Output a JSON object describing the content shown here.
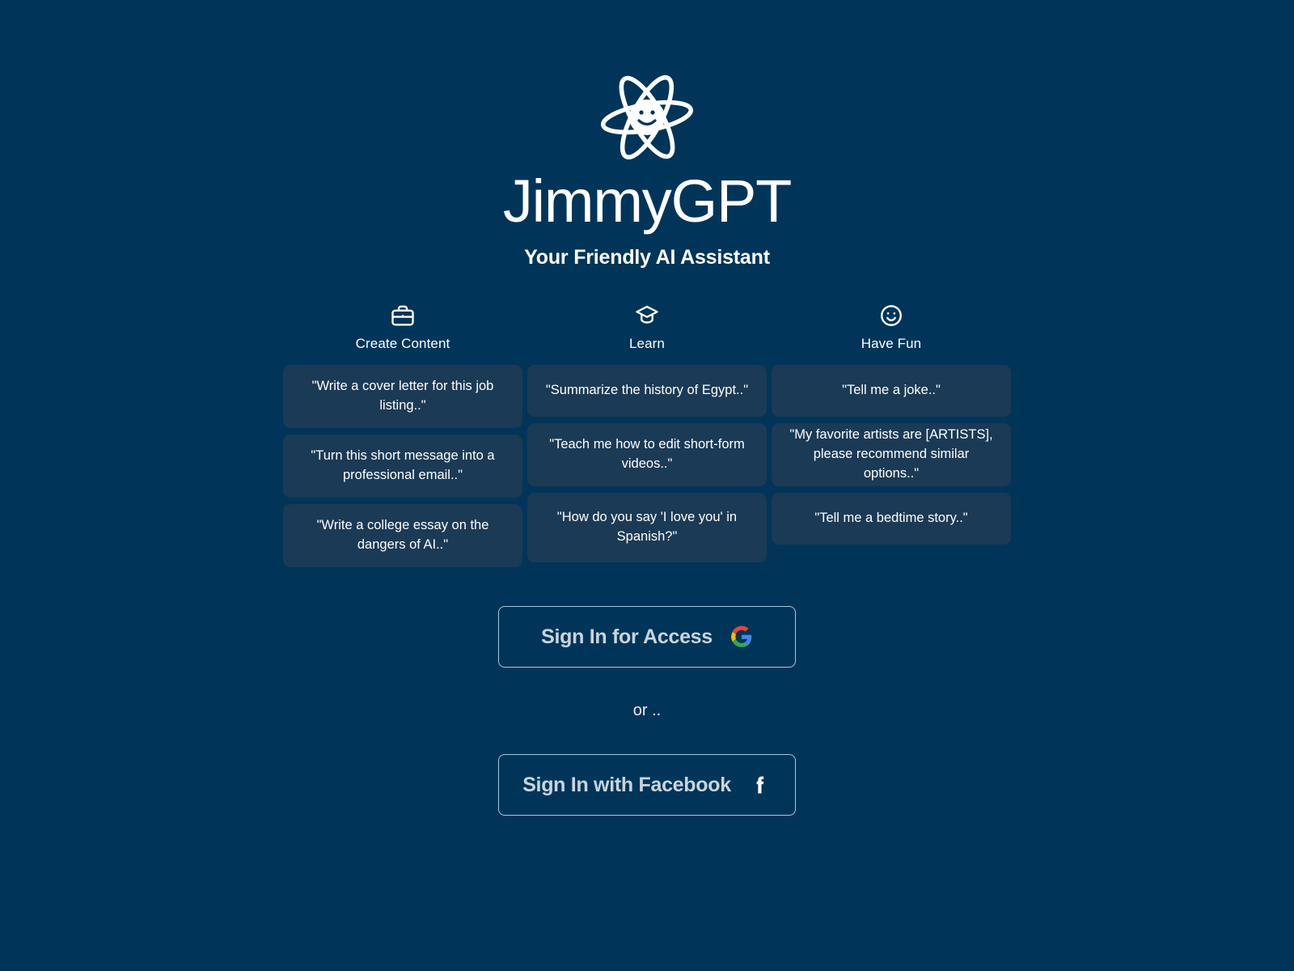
{
  "brand": {
    "logo_icon": "atom-smiley-icon",
    "name": "JimmyGPT",
    "tagline": "Your Friendly AI Assistant",
    "background_color": "#003559",
    "card_color": "#1b3a55",
    "accent_border_color": "#a8c6dc"
  },
  "categories": [
    {
      "id": "create-content",
      "icon": "briefcase-icon",
      "label": "Create Content",
      "prompts": [
        {
          "text": "\"Write a cover letter for this job listing..\"",
          "lines": 2
        },
        {
          "text": "\"Turn this short message into a professional email..\"",
          "lines": 2
        },
        {
          "text": "\"Write a college essay on the dangers of AI..\"",
          "lines": 2
        }
      ]
    },
    {
      "id": "learn",
      "icon": "graduation-cap-icon",
      "label": "Learn",
      "prompts": [
        {
          "text": "\"Summarize the history of Egypt..\"",
          "lines": 1
        },
        {
          "text": "\"Teach me how to edit short-form videos..\"",
          "lines": 2
        },
        {
          "text": "\"How do you say 'I love you' in Spanish?\"",
          "lines": 2
        }
      ]
    },
    {
      "id": "have-fun",
      "icon": "smiley-face-icon",
      "label": "Have Fun",
      "prompts": [
        {
          "text": "\"Tell me a joke..\"",
          "lines": 1
        },
        {
          "text": "\"My favorite artists are [ARTISTS], please recommend similar options..\"",
          "lines": 2
        },
        {
          "text": "\"Tell me a bedtime story..\"",
          "lines": 1
        }
      ]
    }
  ],
  "auth": {
    "google": {
      "label": "Sign In for Access",
      "icon": "google-g-icon",
      "icon_colors": {
        "blue": "#4285F4",
        "green": "#34A853",
        "yellow": "#FBBC05",
        "red": "#EA4335"
      }
    },
    "divider_text": "or ..",
    "facebook": {
      "label": "Sign In with Facebook",
      "icon": "facebook-f-icon",
      "icon_color": "#ffffff"
    }
  }
}
